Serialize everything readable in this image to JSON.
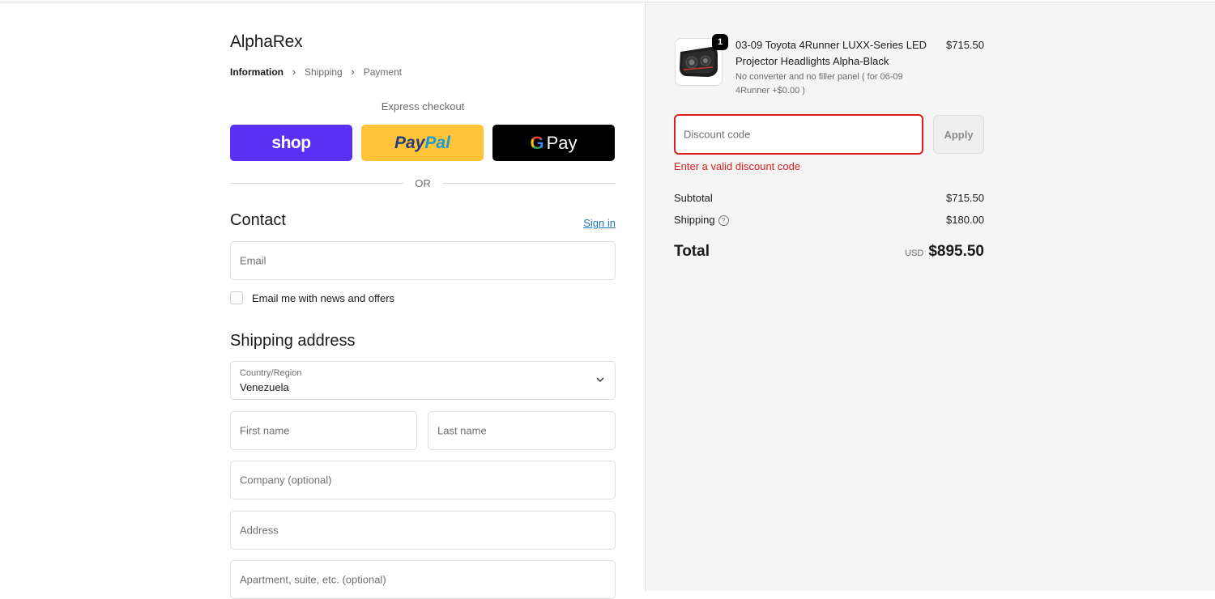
{
  "brand": "AlphaRex",
  "breadcrumb": [
    "Information",
    "Shipping",
    "Payment"
  ],
  "express": {
    "title": "Express checkout",
    "shop_label": "shop",
    "paypal_label_1": "Pay",
    "paypal_label_2": "Pal",
    "gpay_g": "G",
    "gpay_label": "Pay",
    "or_label": "OR"
  },
  "contact": {
    "title": "Contact",
    "sign_in": "Sign in",
    "email_placeholder": "Email",
    "news_label": "Email me with news and offers"
  },
  "shipping": {
    "title": "Shipping address",
    "country_label": "Country/Region",
    "country_value": "Venezuela",
    "first_name_placeholder": "First name",
    "last_name_placeholder": "Last name",
    "company_placeholder": "Company (optional)",
    "address_placeholder": "Address",
    "apartment_placeholder": "Apartment, suite, etc. (optional)"
  },
  "cart": {
    "quantity": "1",
    "product_title": "03-09 Toyota 4Runner LUXX-Series LED Projector Headlights Alpha-Black",
    "variant": "No converter and no filler panel ( for 06-09 4Runner +$0.00 )",
    "price": "$715.50"
  },
  "discount": {
    "placeholder": "Discount code",
    "apply_label": "Apply",
    "error": "Enter a valid discount code"
  },
  "summary": {
    "subtotal_label": "Subtotal",
    "subtotal_value": "$715.50",
    "shipping_label": "Shipping",
    "shipping_value": "$180.00",
    "total_label": "Total",
    "currency": "USD",
    "total_value": "$895.50"
  },
  "colors": {
    "shop": "#5a31f4",
    "paypal": "#ffc439",
    "gpay": "#000000",
    "link": "#1773b0",
    "error": "#dd1d1d"
  }
}
